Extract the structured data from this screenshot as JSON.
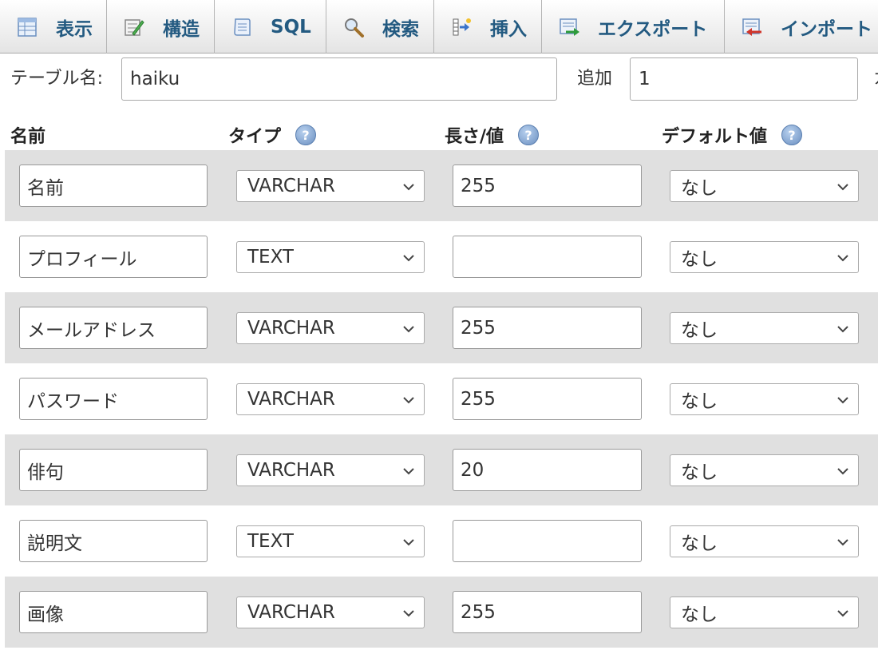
{
  "tabs": [
    {
      "label": "表示",
      "icon": "browse-table-icon"
    },
    {
      "label": "構造",
      "icon": "structure-icon"
    },
    {
      "label": "SQL",
      "icon": "sql-document-icon"
    },
    {
      "label": "検索",
      "icon": "magnifier-icon"
    },
    {
      "label": "挿入",
      "icon": "insert-row-icon"
    },
    {
      "label": "エクスポート",
      "icon": "export-icon"
    },
    {
      "label": "インポート",
      "icon": "import-icon"
    }
  ],
  "table_form": {
    "table_name_label": "テーブル名:",
    "table_name_value": "haiku",
    "add_label": "追加",
    "add_value": "1",
    "cut_label": "カ"
  },
  "columns": {
    "name": "名前",
    "type": "タイプ",
    "length": "長さ/値",
    "default": "デフォルト値"
  },
  "help_icon_glyph": "?",
  "fields": [
    {
      "name": "名前",
      "type": "VARCHAR",
      "length": "255",
      "default": "なし"
    },
    {
      "name": "プロフィール",
      "type": "TEXT",
      "length": "",
      "default": "なし"
    },
    {
      "name": "メールアドレス",
      "type": "VARCHAR",
      "length": "255",
      "default": "なし"
    },
    {
      "name": "パスワード",
      "type": "VARCHAR",
      "length": "255",
      "default": "なし"
    },
    {
      "name": "俳句",
      "type": "VARCHAR",
      "length": "20",
      "default": "なし"
    },
    {
      "name": "説明文",
      "type": "TEXT",
      "length": "",
      "default": "なし"
    },
    {
      "name": "画像",
      "type": "VARCHAR",
      "length": "255",
      "default": "なし"
    }
  ],
  "colors": {
    "tab_text": "#235a81",
    "row_stripe": "#e0e0e0",
    "help_icon": "#6b8fc0"
  }
}
